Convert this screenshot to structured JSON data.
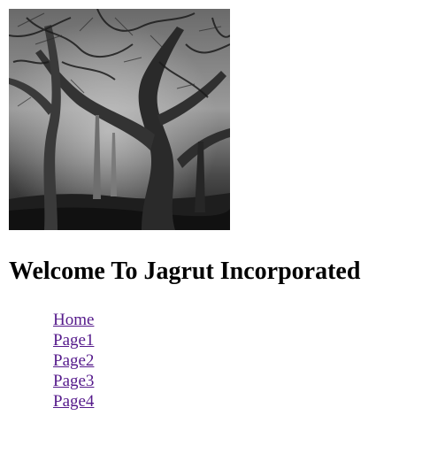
{
  "page": {
    "title": "Welcome To Jagrut Incorporated"
  },
  "hero_image": {
    "description_icon": "forest-photo"
  },
  "nav": {
    "items": [
      {
        "label": "Home"
      },
      {
        "label": "Page1"
      },
      {
        "label": "Page2"
      },
      {
        "label": "Page3"
      },
      {
        "label": "Page4"
      }
    ]
  },
  "colors": {
    "link_visited": "#551a8b",
    "text": "#000000",
    "background": "#ffffff"
  }
}
